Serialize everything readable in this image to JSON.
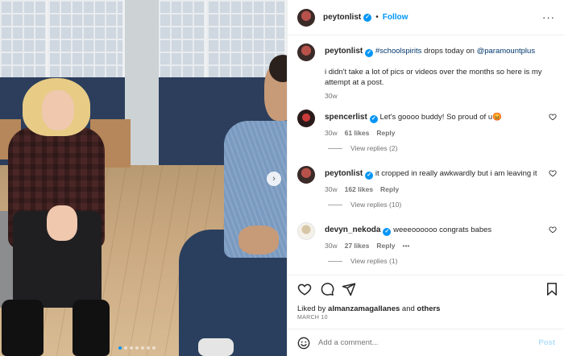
{
  "post": {
    "carousel": {
      "slide_count": 7,
      "active_index": 0
    },
    "header": {
      "username": "peytonlist",
      "separator": "•",
      "follow_label": "Follow",
      "more_label": "···"
    },
    "caption": {
      "username": "peytonlist",
      "hashtag": "#schoolspirits",
      "text_mid": " drops today on ",
      "mention": "@paramountplus",
      "text_second": "i didn't take a lot of pics or videos over the months so here is my attempt at a post.",
      "age": "30w"
    },
    "comments": [
      {
        "username": "spencerlist",
        "text": "Let's goooo buddy! So proud of u",
        "emoji": "😡",
        "age": "30w",
        "likes": "61 likes",
        "reply_label": "Reply",
        "view_replies": "View replies (2)"
      },
      {
        "username": "peytonlist",
        "text": "it cropped in really awkwardly but i am leaving it",
        "age": "30w",
        "likes": "162 likes",
        "reply_label": "Reply",
        "view_replies": "View replies (10)"
      },
      {
        "username": "devyn_nekoda",
        "text": "weeeoooooo congrats babes",
        "age": "30w",
        "likes": "27 likes",
        "reply_label": "Reply",
        "more": "•••",
        "view_replies": "View replies (1)"
      }
    ],
    "liked_by": {
      "prefix": "Liked by ",
      "user": "almanzamagallanes",
      "suffix": " and ",
      "others": "others"
    },
    "date": "MARCH 10",
    "add_comment": {
      "placeholder": "Add a comment...",
      "post_label": "Post"
    }
  },
  "colors": {
    "accent": "#0095f6",
    "text": "#262626",
    "muted": "#737373",
    "link": "#00376b",
    "post_disabled": "#b3dffc"
  },
  "icons": [
    "next-arrow-icon",
    "more-icon",
    "verified-icon",
    "heart-icon",
    "comment-icon",
    "share-icon",
    "bookmark-icon",
    "emoji-icon"
  ]
}
